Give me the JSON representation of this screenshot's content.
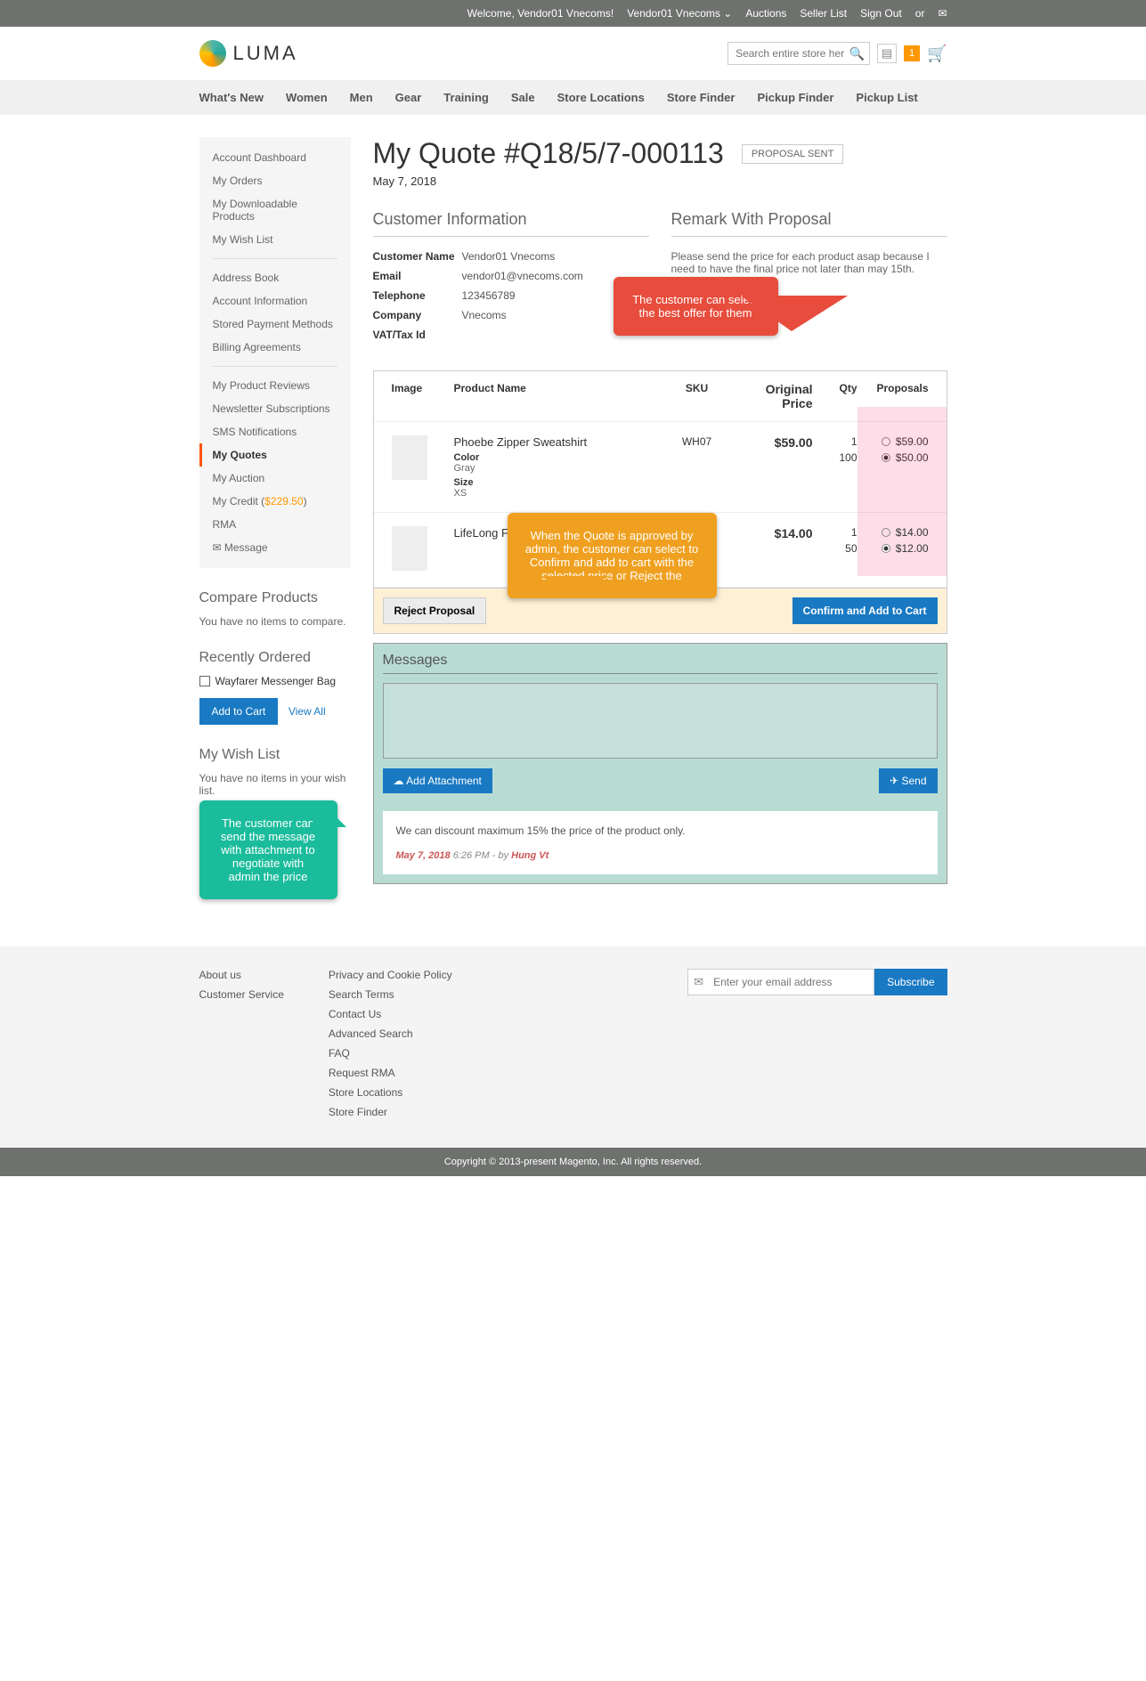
{
  "topbar": {
    "welcome": "Welcome, Vendor01 Vnecoms!",
    "user": "Vendor01 Vnecoms",
    "links": [
      "Auctions",
      "Seller List",
      "Sign Out",
      "or"
    ]
  },
  "logo": "LUMA",
  "search": {
    "placeholder": "Search entire store here..."
  },
  "badge_count": "1",
  "nav": [
    "What's New",
    "Women",
    "Men",
    "Gear",
    "Training",
    "Sale",
    "Store Locations",
    "Store Finder",
    "Pickup Finder",
    "Pickup List"
  ],
  "sidebar": {
    "g1": [
      "Account Dashboard",
      "My Orders",
      "My Downloadable Products",
      "My Wish List"
    ],
    "g2": [
      "Address Book",
      "Account Information",
      "Stored Payment Methods",
      "Billing Agreements"
    ],
    "g3": [
      "My Product Reviews",
      "Newsletter Subscriptions",
      "SMS Notifications",
      "My Quotes",
      "My Auction"
    ],
    "credit_label": "My Credit (",
    "credit_amt": "$229.50",
    "credit_close": ")",
    "g4": [
      "RMA",
      "✉ Message"
    ]
  },
  "compare": {
    "title": "Compare Products",
    "empty": "You have no items to compare."
  },
  "recent": {
    "title": "Recently Ordered",
    "item": "Wayfarer Messenger Bag",
    "add": "Add to Cart",
    "view": "View All"
  },
  "wishlist": {
    "title": "My Wish List",
    "empty": "You have no items in your wish list."
  },
  "page": {
    "title": "My Quote #Q18/5/7-000113",
    "status": "PROPOSAL SENT",
    "date": "May 7, 2018"
  },
  "cust": {
    "title": "Customer Information",
    "rows": [
      {
        "l": "Customer Name",
        "v": "Vendor01 Vnecoms"
      },
      {
        "l": "Email",
        "v": "vendor01@vnecoms.com"
      },
      {
        "l": "Telephone",
        "v": "123456789"
      },
      {
        "l": "Company",
        "v": "Vnecoms"
      },
      {
        "l": "VAT/Tax Id",
        "v": ""
      }
    ]
  },
  "remark": {
    "title": "Remark With Proposal",
    "text": "Please send the price for each product asap because I need to have the final price not later than may 15th."
  },
  "table": {
    "headers": [
      "Image",
      "Product Name",
      "SKU",
      "Original Price",
      "Qty",
      "Proposals"
    ],
    "rows": [
      {
        "name": "Phoebe Zipper Sweatshirt",
        "sku": "WH07",
        "price": "$59.00",
        "attrs": [
          {
            "l": "Color",
            "v": "Gray"
          },
          {
            "l": "Size",
            "v": "XS"
          }
        ],
        "props": [
          {
            "qty": "1",
            "price": "$59.00",
            "sel": false
          },
          {
            "qty": "100",
            "price": "$50.00",
            "sel": true
          }
        ]
      },
      {
        "name": "LifeLong F",
        "sku": "",
        "price": "$14.00",
        "attrs": [],
        "props": [
          {
            "qty": "1",
            "price": "$14.00",
            "sel": false
          },
          {
            "qty": "50",
            "price": "$12.00",
            "sel": true
          }
        ]
      }
    ]
  },
  "actions": {
    "reject": "Reject Proposal",
    "confirm": "Confirm and Add to Cart"
  },
  "messages": {
    "title": "Messages",
    "attach": "☁ Add Attachment",
    "send": "✈ Send",
    "history_text": "We can discount maximum 15% the price of the product only.",
    "history_date": "May 7, 2018",
    "history_time": " 6:26 PM - by ",
    "history_by": "Hung Vt"
  },
  "callouts": {
    "c1": "The customer can select the best offer for them",
    "c2": "When the Quote is approved by admin, the customer can select to Confirm and add to cart with the selected price or Reject the",
    "c3": "The customer can send the message with attachment to negotiate with admin the price"
  },
  "footer": {
    "col1": [
      "About us",
      "Customer Service"
    ],
    "col2": [
      "Privacy and Cookie Policy",
      "Search Terms",
      "Contact Us",
      "Advanced Search",
      "FAQ",
      "Request RMA",
      "Store Locations",
      "Store Finder"
    ],
    "nl_placeholder": "Enter your email address",
    "subscribe": "Subscribe"
  },
  "copyright": "Copyright © 2013-present Magento, Inc. All rights reserved."
}
